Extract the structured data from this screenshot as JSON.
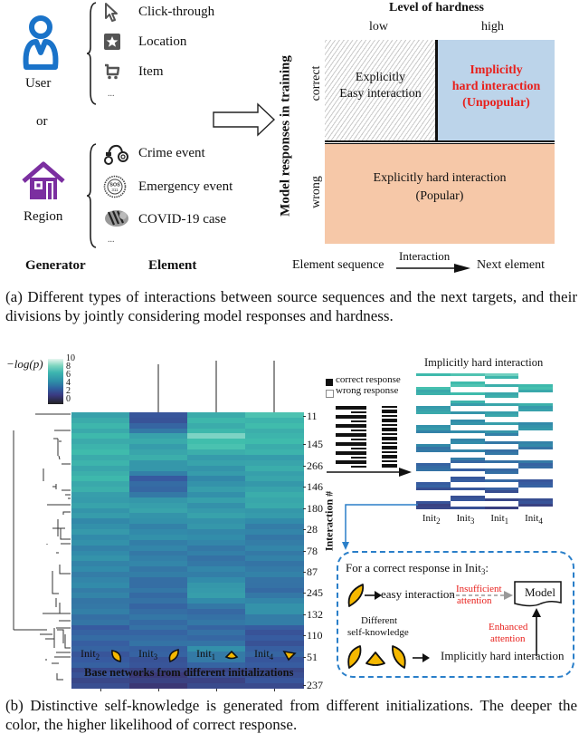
{
  "panel_a": {
    "generators": [
      {
        "label": "User",
        "icon": "user-icon",
        "color": "#1a73c9",
        "elements": [
          {
            "label": "Click-through",
            "icon": "cursor-arrow-icon"
          },
          {
            "label": "Location",
            "icon": "star-location-icon"
          },
          {
            "label": "Item",
            "icon": "shopping-cart-icon"
          },
          {
            "label": "...",
            "icon": ""
          }
        ]
      },
      {
        "label": "Region",
        "icon": "house-icon",
        "color": "#7b2fa0",
        "elements": [
          {
            "label": "Crime event",
            "icon": "handcuffs-icon"
          },
          {
            "label": "Emergency event",
            "icon": "sos-badge-icon"
          },
          {
            "label": "COVID-19 case",
            "icon": "virus-icon"
          },
          {
            "label": "...",
            "icon": ""
          }
        ]
      }
    ],
    "or_label": "or",
    "generator_header": "Generator",
    "element_header": "Element",
    "matrix": {
      "title": "Level of hardness",
      "col_low": "low",
      "col_high": "high",
      "y_title": "Model responses in training",
      "row_correct": "correct",
      "row_wrong": "wrong",
      "cell_easy_line1": "Explicitly",
      "cell_easy_line2": "Easy interaction",
      "cell_implicit_line1": "Implicitly",
      "cell_implicit_line2": "hard interaction",
      "cell_implicit_line3": "(Unpopular)",
      "cell_explicit_line1": "Explicitly hard interaction",
      "cell_explicit_line2": "(Popular)",
      "colors": {
        "implicit_bg": "#bcd4ea",
        "implicit_text": "#e8201c",
        "explicit_bg": "#f6c8a8"
      }
    },
    "flow": {
      "left": "Element sequence",
      "arrow_label": "Interaction",
      "right": "Next element"
    },
    "caption": "(a) Different types of interactions between source sequences and the next targets, and their divisions by jointly considering model responses and hardness."
  },
  "panel_b": {
    "colorbar": {
      "label": "−log(p)",
      "ticks": [
        "10",
        "8",
        "6",
        "4",
        "2",
        "0"
      ]
    },
    "row_labels": [
      "11",
      "145",
      "266",
      "146",
      "180",
      "28",
      "78",
      "87",
      "245",
      "132",
      "110",
      "51",
      "237"
    ],
    "y_axis_title": "Interaction #",
    "columns": [
      {
        "name": "Init",
        "sub": "2"
      },
      {
        "name": "Init",
        "sub": "3"
      },
      {
        "name": "Init",
        "sub": "1"
      },
      {
        "name": "Init",
        "sub": "4"
      }
    ],
    "x_axis_title": "Base networks from different initializations",
    "binary_legend": {
      "correct": "correct response",
      "wrong": "wrong response"
    },
    "implicit_title": "Implicitly hard interaction",
    "implicit_columns": [
      {
        "name": "Init",
        "sub": "2"
      },
      {
        "name": "Init",
        "sub": "3"
      },
      {
        "name": "Init",
        "sub": "1"
      },
      {
        "name": "Init",
        "sub": "4"
      }
    ],
    "box": {
      "title": "For a correct response in Init",
      "title_sub": "3",
      "title_suffix": ":",
      "easy": "easy interaction",
      "insufficient_line1": "Insufficient",
      "insufficient_line2": "attention",
      "model": "Model",
      "different_line1": "Different",
      "different_line2": "self-knowledge",
      "enhanced_line1": "Enhanced",
      "enhanced_line2": "attention",
      "implicit": "Implicitly hard interaction",
      "colors": {
        "border": "#2a7fc9",
        "red": "#e8201c",
        "leaf": "#f5b800"
      }
    },
    "caption": "(b) Distinctive self-knowledge is generated from different initializations. The deeper the color, the higher likelihood of correct response."
  },
  "chart_data": {
    "type": "heatmap",
    "title": "",
    "xlabel": "Base networks from different initializations",
    "ylabel": "Interaction #",
    "x": [
      "Init2",
      "Init3",
      "Init1",
      "Init4"
    ],
    "y_tick_labels": [
      "11",
      "145",
      "266",
      "146",
      "180",
      "28",
      "78",
      "87",
      "245",
      "132",
      "110",
      "51",
      "237"
    ],
    "colorbar": {
      "label": "-log(p)",
      "range": [
        0,
        10
      ]
    },
    "values_by_row_band": [
      [
        7.2,
        3.6,
        7.4,
        7.8
      ],
      [
        7.6,
        7.0,
        8.4,
        7.6
      ],
      [
        7.4,
        7.0,
        6.6,
        7.0
      ],
      [
        7.4,
        4.0,
        6.2,
        6.8
      ],
      [
        6.6,
        6.8,
        6.6,
        7.2
      ],
      [
        6.2,
        6.0,
        6.4,
        5.6
      ],
      [
        6.0,
        5.6,
        5.4,
        5.4
      ],
      [
        5.8,
        5.4,
        5.2,
        5.4
      ],
      [
        5.6,
        4.8,
        6.8,
        4.8
      ],
      [
        5.2,
        4.8,
        5.0,
        6.4
      ],
      [
        4.4,
        4.8,
        4.6,
        3.8
      ],
      [
        4.2,
        4.4,
        5.8,
        4.2
      ],
      [
        3.4,
        2.6,
        3.0,
        3.4
      ]
    ]
  }
}
